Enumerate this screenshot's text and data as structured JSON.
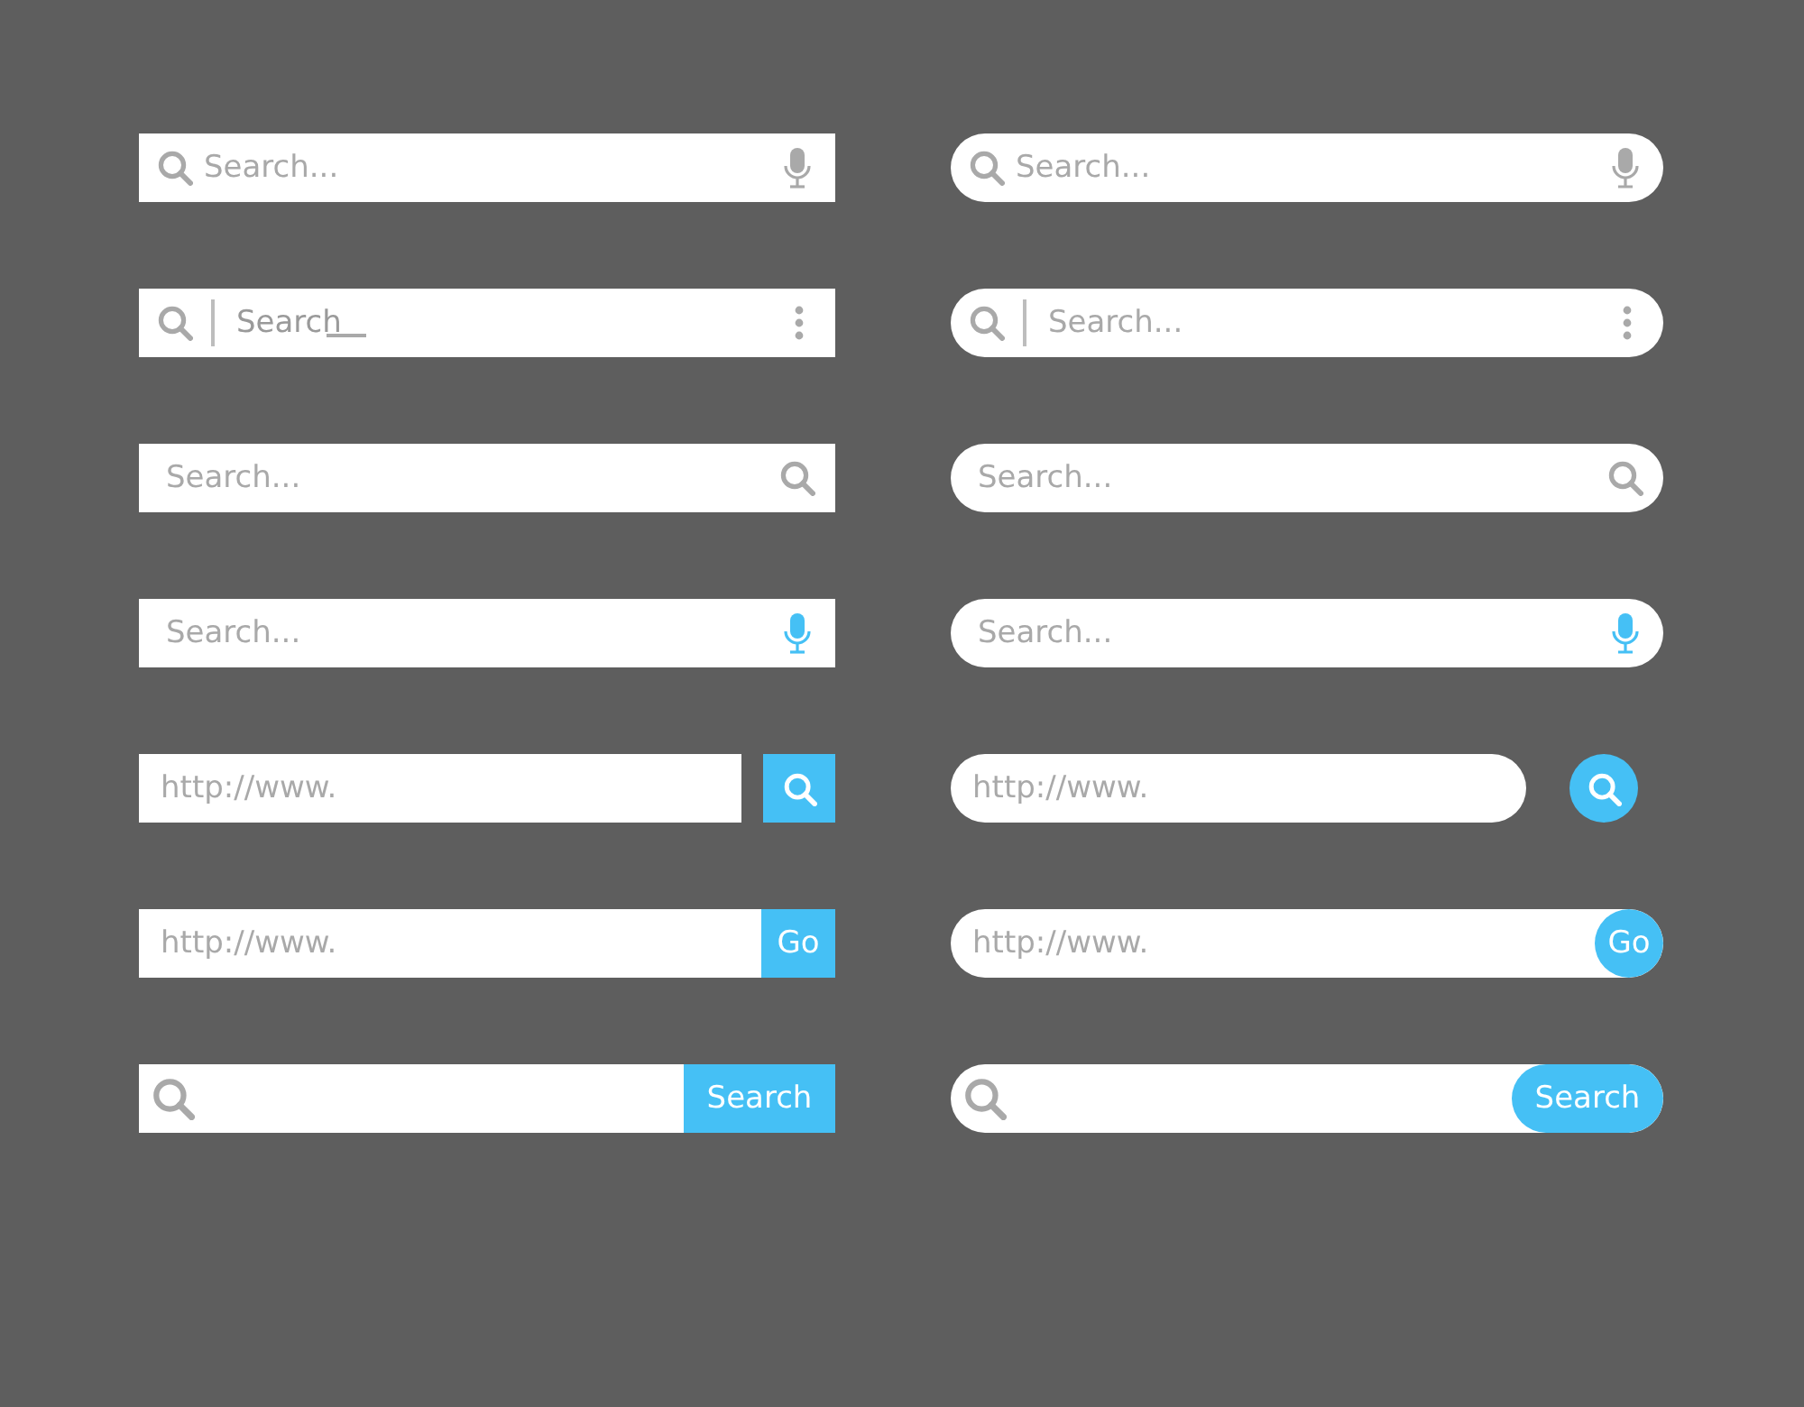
{
  "columns": [
    {
      "kind": "square",
      "bars": [
        {
          "kind": "leading-icon-mic",
          "placeholder": "Search..."
        },
        {
          "kind": "leading-icon-menu",
          "value": "Search",
          "cursor": true
        },
        {
          "kind": "trailing-search",
          "placeholder": "Search..."
        },
        {
          "kind": "trailing-mic",
          "placeholder": "Search..."
        },
        {
          "kind": "url-icon-button",
          "placeholder": "http://www."
        },
        {
          "kind": "url-text-button",
          "placeholder": "http://www.",
          "button": "Go"
        },
        {
          "kind": "icon-text-button",
          "button": "Search"
        }
      ]
    },
    {
      "kind": "rounded",
      "bars": [
        {
          "kind": "leading-icon-mic",
          "placeholder": "Search..."
        },
        {
          "kind": "leading-icon-menu",
          "placeholder": "Search...",
          "cursor": false
        },
        {
          "kind": "trailing-search",
          "placeholder": "Search..."
        },
        {
          "kind": "trailing-mic",
          "placeholder": "Search..."
        },
        {
          "kind": "url-icon-button",
          "placeholder": "http://www."
        },
        {
          "kind": "url-text-button",
          "placeholder": "http://www.",
          "button": "Go"
        },
        {
          "kind": "icon-text-button",
          "button": "Search"
        }
      ]
    }
  ]
}
